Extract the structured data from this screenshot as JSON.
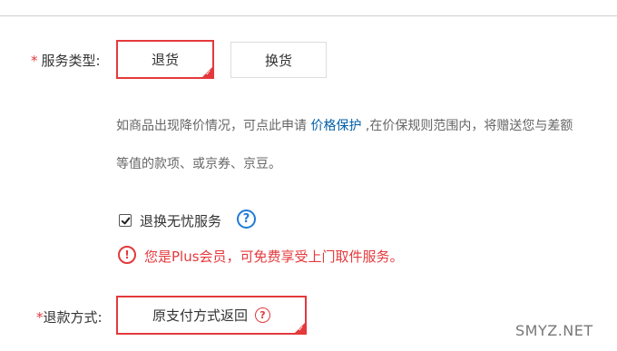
{
  "service_type": {
    "label": "服务类型:",
    "required_mark": "*",
    "options": [
      {
        "label": "退货",
        "selected": true
      },
      {
        "label": "换货",
        "selected": false
      }
    ]
  },
  "description": {
    "line1_prefix": "如商品出现降价情况，可点此申请 ",
    "link": "价格保护",
    "line1_suffix": " ,在价保规则范围内，将赠送您与差额",
    "line2": "等值的款项、或京券、京豆。"
  },
  "worry_free": {
    "label": "退换无忧服务",
    "checked": true
  },
  "plus_notice": {
    "text": "您是Plus会员，可免费享受上门取件服务。"
  },
  "refund_method": {
    "required_mark": "*",
    "label": "退款方式:",
    "option": "原支付方式返回"
  },
  "watermark": "SMYZ.NET",
  "colors": {
    "accent_red": "#e4393c",
    "link_blue": "#005ea7",
    "help_blue": "#1e7bd6",
    "text": "#333333"
  },
  "icons": {
    "help": "question-circle-icon",
    "warning": "exclamation-circle-icon",
    "check": "checkmark-icon"
  }
}
